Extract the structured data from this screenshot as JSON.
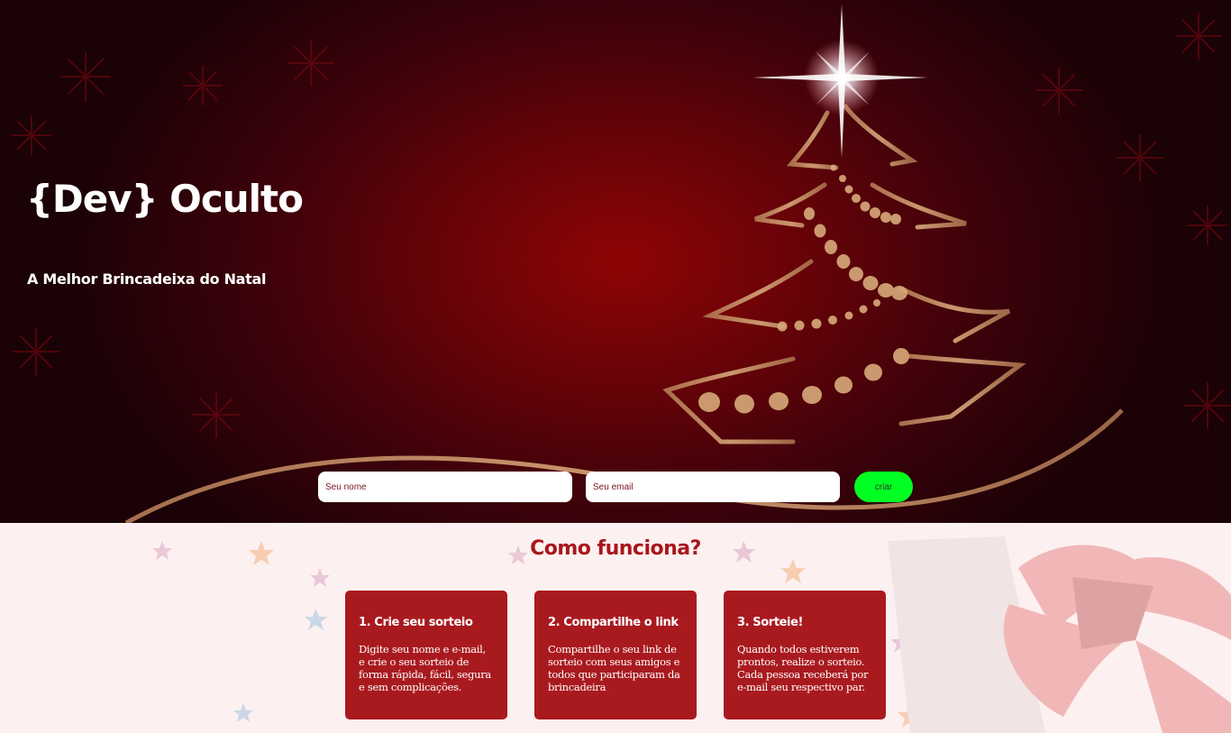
{
  "hero": {
    "title": "{Dev} Oculto",
    "subtitle": "A Melhor Brincadeixa do Natal"
  },
  "form": {
    "name_placeholder": "Seu nome",
    "email_placeholder": "Seu email",
    "submit_label": "criar"
  },
  "how": {
    "title": "Como funciona?",
    "steps": [
      {
        "title": "1. Crie seu sorteio",
        "text": "Digite seu nome e e-mail, e crie o seu sorteio de forma rápida, fácil, segura e sem complicações."
      },
      {
        "title": "2. Compartilhe o link",
        "text": "Compartilhe o seu link de sorteio com seus amigos e todos que participaram da brincadeira"
      },
      {
        "title": "3. Sorteie!",
        "text": "Quando todos estiverem prontos, realize o sorteio. Cada pessoa receberá por e-mail seu respectivo par."
      }
    ]
  },
  "colors": {
    "hero_red": "#8e0404",
    "accent_green": "#00ff22",
    "card_red": "#a91a1f",
    "heading_red": "#a8161c",
    "gold": "#c8946a"
  }
}
